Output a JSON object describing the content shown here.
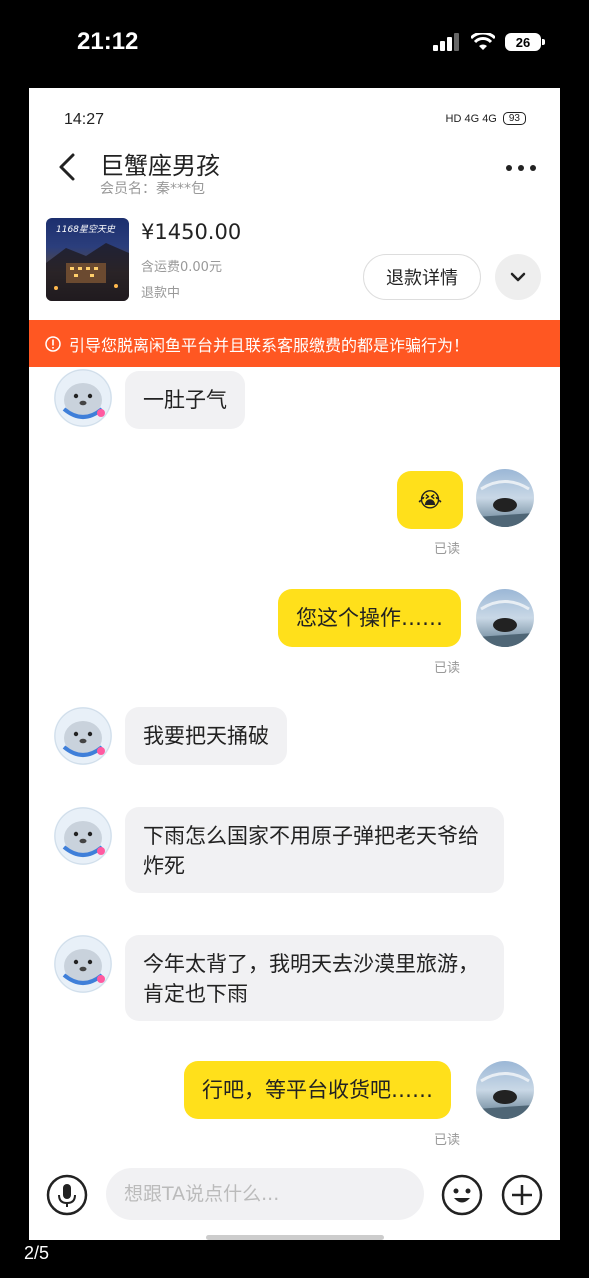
{
  "outer_status": {
    "time": "21:12",
    "battery": "26"
  },
  "inner_status": {
    "time": "14:27",
    "network": "HD 4G 4G",
    "battery": "93"
  },
  "header": {
    "title": "巨蟹座男孩",
    "subtitle": "会员名：秦***包"
  },
  "product": {
    "thumb_text": "1168星空天史",
    "price": "¥1450.00",
    "shipping": "含运费0.00元",
    "status": "退款中",
    "refund_button": "退款详情"
  },
  "warning": {
    "text": "引导您脱离闲鱼平台并且联系客服缴费的都是诈骗行为！"
  },
  "messages": [
    {
      "from": "other",
      "text": "一肚子气"
    },
    {
      "from": "me",
      "text": "😭",
      "read": "已读"
    },
    {
      "from": "me",
      "text": "您这个操作……",
      "read": "已读"
    },
    {
      "from": "other",
      "text": "我要把天捅破"
    },
    {
      "from": "other",
      "text": "下雨怎么国家不用原子弹把老天爷给炸死"
    },
    {
      "from": "other",
      "text": "今年太背了，我明天去沙漠里旅游，肯定也下雨"
    },
    {
      "from": "me",
      "text": "行吧，等平台收货吧……",
      "read": "已读"
    }
  ],
  "input": {
    "placeholder": "想跟TA说点什么..."
  },
  "page_indicator": "2/5",
  "colors": {
    "warning_bg": "#ff5722",
    "my_bubble": "#ffe01b",
    "their_bubble": "#f1f1f3"
  }
}
